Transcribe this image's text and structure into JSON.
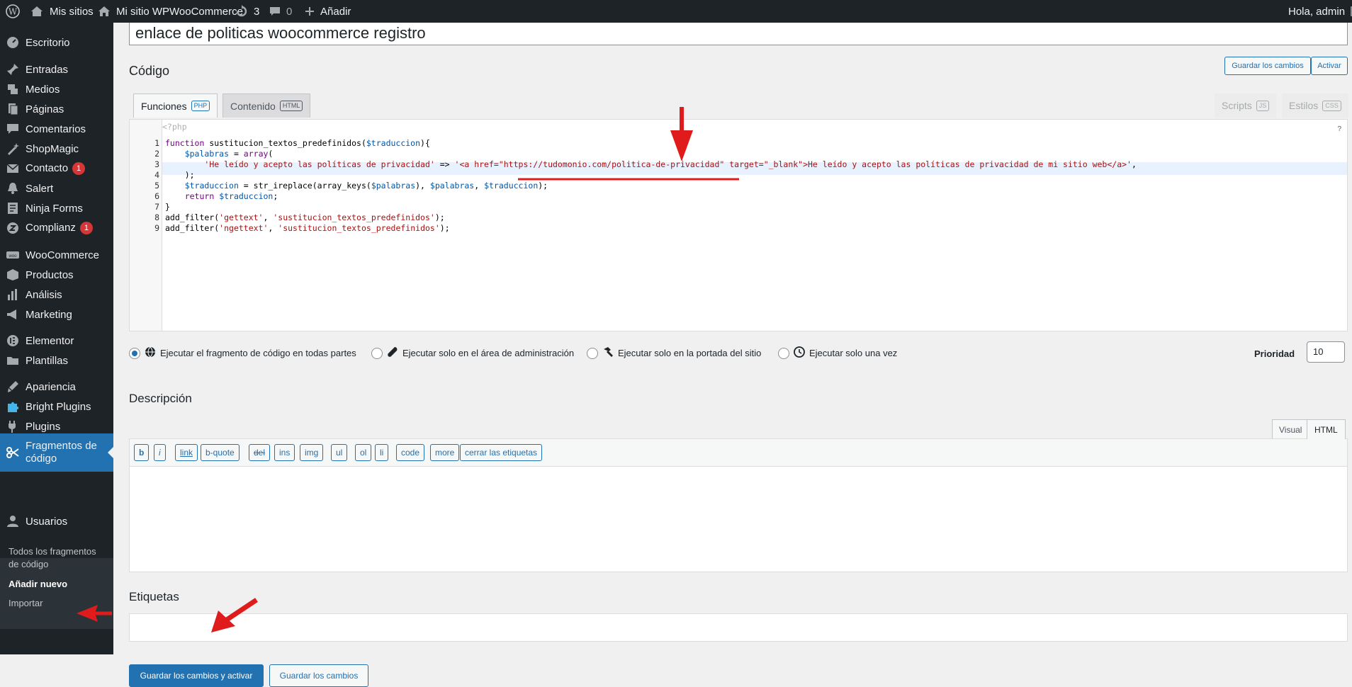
{
  "adminbar": {
    "my_sites": "Mis sitios",
    "site_name": "Mi sitio WPWooCommerce",
    "updates_count": "3",
    "comments_count": "0",
    "add_new": "Añadir",
    "greeting": "Hola, admin"
  },
  "sidebar": {
    "items": [
      {
        "label": "Escritorio",
        "icon": "dashboard-icon"
      },
      {
        "label": "Entradas",
        "icon": "pin-icon"
      },
      {
        "label": "Medios",
        "icon": "media-icon"
      },
      {
        "label": "Páginas",
        "icon": "pages-icon"
      },
      {
        "label": "Comentarios",
        "icon": "comments-icon"
      },
      {
        "label": "ShopMagic",
        "icon": "magic-icon"
      },
      {
        "label": "Contacto",
        "icon": "mail-icon",
        "badge": "1"
      },
      {
        "label": "Salert",
        "icon": "bell-icon"
      },
      {
        "label": "Ninja Forms",
        "icon": "forms-icon"
      },
      {
        "label": "Complianz",
        "icon": "complianz-icon",
        "badge": "1"
      },
      {
        "label": "WooCommerce",
        "icon": "woo-icon"
      },
      {
        "label": "Productos",
        "icon": "products-icon"
      },
      {
        "label": "Análisis",
        "icon": "analytics-icon"
      },
      {
        "label": "Marketing",
        "icon": "megaphone-icon"
      },
      {
        "label": "Elementor",
        "icon": "elementor-icon"
      },
      {
        "label": "Plantillas",
        "icon": "folder-icon"
      },
      {
        "label": "Apariencia",
        "icon": "brush-icon"
      },
      {
        "label": "Bright Plugins",
        "icon": "puzzle-icon"
      },
      {
        "label": "Plugins",
        "icon": "plug-icon"
      },
      {
        "label": "Fragmentos de código",
        "icon": "scissors-icon"
      },
      {
        "label": "Usuarios",
        "icon": "user-icon"
      }
    ],
    "submenu": {
      "all": "Todos los fragmentos de código",
      "add_new": "Añadir nuevo",
      "import": "Importar"
    }
  },
  "main": {
    "snippet_title": "enlace de politicas woocommerce registro",
    "code_heading": "Código",
    "save_changes_label": "Guardar los cambios",
    "activate_label": "Activar",
    "tabs": [
      {
        "label": "Funciones",
        "tag": "PHP"
      },
      {
        "label": "Contenido",
        "tag": "HTML"
      },
      {
        "label": "Scripts",
        "tag": "JS"
      },
      {
        "label": "Estilos",
        "tag": "CSS"
      }
    ],
    "php_open": "<?php",
    "help_mark": "?",
    "code_lines": [
      "function sustitucion_textos_predefinidos($traduccion){",
      "    $palabras = array(",
      "        'He leído y acepto las políticas de privacidad' => '<a href=\"https://tudomonio.com/politica-de-privacidad\" target=\"_blank\">He leído y acepto las políticas de privacidad de mi sitio web</a>',",
      "    );",
      "    $traduccion = str_ireplace(array_keys($palabras), $palabras, $traduccion);",
      "    return $traduccion;",
      "}",
      "add_filter('gettext', 'sustitucion_textos_predefinidos');",
      "add_filter('ngettext', 'sustitucion_textos_predefinidos');"
    ],
    "line_numbers": [
      "1",
      "2",
      "3",
      "4",
      "5",
      "6",
      "7",
      "8",
      "9"
    ],
    "scope_options": [
      {
        "label": "Ejecutar el fragmento de código en todas partes",
        "icon": "globe-icon",
        "selected": true
      },
      {
        "label": "Ejecutar solo en el área de administración",
        "icon": "wrench-icon",
        "selected": false
      },
      {
        "label": "Ejecutar solo en la portada del sitio",
        "icon": "hammer-icon",
        "selected": false
      },
      {
        "label": "Ejecutar solo una vez",
        "icon": "clock-icon",
        "selected": false
      }
    ],
    "priority_label": "Prioridad",
    "priority_value": "10",
    "description_heading": "Descripción",
    "editor_tabs": [
      "Visual",
      "HTML"
    ],
    "quicktags": [
      "b",
      "i",
      "link",
      "b-quote",
      "del",
      "ins",
      "img",
      "ul",
      "ol",
      "li",
      "code",
      "more",
      "cerrar las etiquetas"
    ],
    "tags_heading": "Etiquetas",
    "save_activate_label": "Guardar los cambios y activar",
    "save_bottom_label": "Guardar los cambios"
  },
  "colors": {
    "accent": "#2271b1",
    "annotation": "#e01b1b",
    "sidebar_bg": "#1d2327"
  }
}
